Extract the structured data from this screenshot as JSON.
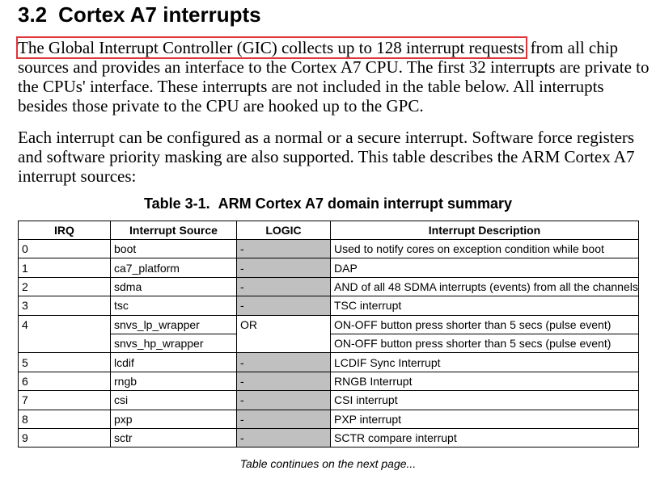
{
  "section": {
    "number": "3.2",
    "title": "Cortex A7 interrupts"
  },
  "paragraph1": {
    "highlighted": "The Global Interrupt Controller (GIC) collects up to 128 interrupt requests",
    "rest": " from all chip sources and provides an interface to the Cortex A7 CPU. The first 32 interrupts are private to the CPUs' interface. These interrupts are not included in the table below. All interrupts besides those private to the CPU are hooked up to the GPC."
  },
  "paragraph2": "Each interrupt can be configured as a normal or a secure interrupt. Software force registers and software priority masking are also supported. This table describes the ARM Cortex A7 interrupt sources:",
  "table": {
    "caption": "Table 3-1.  ARM Cortex A7 domain interrupt summary",
    "headers": [
      "IRQ",
      "Interrupt Source",
      "LOGIC",
      "Interrupt Description"
    ],
    "rows": [
      {
        "irq": "0",
        "source": "boot",
        "logic": "-",
        "desc": "Used to notify cores on exception condition while boot"
      },
      {
        "irq": "1",
        "source": "ca7_platform",
        "logic": "-",
        "desc": "DAP"
      },
      {
        "irq": "2",
        "source": "sdma",
        "logic": "-",
        "desc": "AND of all 48 SDMA interrupts (events) from all the channels"
      },
      {
        "irq": "3",
        "source": "tsc",
        "logic": "-",
        "desc": "TSC interrupt"
      },
      {
        "irq": "4",
        "source": "snvs_lp_wrapper",
        "logic": "OR",
        "desc": "ON-OFF button press shorter than 5 secs (pulse event)"
      },
      {
        "irq": "",
        "source": "snvs_hp_wrapper",
        "logic": "",
        "desc": "ON-OFF button press shorter than 5 secs (pulse event)"
      },
      {
        "irq": "5",
        "source": "lcdif",
        "logic": "-",
        "desc": "LCDIF Sync Interrupt"
      },
      {
        "irq": "6",
        "source": "rngb",
        "logic": "-",
        "desc": "RNGB Interrupt"
      },
      {
        "irq": "7",
        "source": "csi",
        "logic": "-",
        "desc": "CSI interrupt"
      },
      {
        "irq": "8",
        "source": "pxp",
        "logic": "-",
        "desc": "PXP interrupt"
      },
      {
        "irq": "9",
        "source": "sctr",
        "logic": "-",
        "desc": "SCTR compare interrupt"
      }
    ]
  },
  "footer": "Table continues on the next page...",
  "colors": {
    "highlight_box": "#e0353a",
    "logic_cell_fill": "#c0c0c0"
  }
}
